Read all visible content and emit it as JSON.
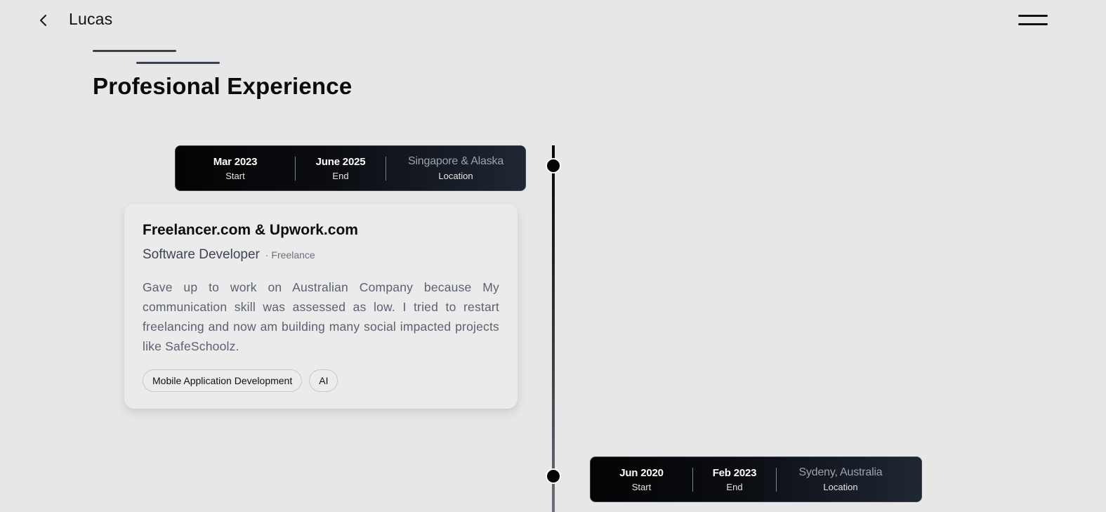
{
  "header": {
    "title": "Lucas",
    "back_icon": "chevron-left-icon",
    "menu_icon": "hamburger-menu-icon"
  },
  "section": {
    "title": "Profesional Experience"
  },
  "experiences": [
    {
      "start_value": "Mar 2023",
      "start_caption": "Start",
      "end_value": "June 2025",
      "end_caption": "End",
      "location_value": "Singapore & Alaska",
      "location_caption": "Location",
      "company": "Freelancer.com & Upwork.com",
      "role": "Software Developer",
      "role_type": "· Freelance",
      "description": "Gave up to work on Australian Company because My communication skill was assessed as low. I tried to restart freelancing and now am building many social impacted projects like SafeSchoolz.",
      "tags": [
        "Mobile Application Development",
        "AI"
      ]
    },
    {
      "start_value": "Jun 2020",
      "start_caption": "Start",
      "end_value": "Feb 2023",
      "end_caption": "End",
      "location_value": "Sydeny, Australia",
      "location_caption": "Location"
    }
  ],
  "colors": {
    "background": "#e7e7e7",
    "bar_dark": "#030303",
    "bar_light": "#1f2733",
    "accent_line": "#3a4250"
  }
}
